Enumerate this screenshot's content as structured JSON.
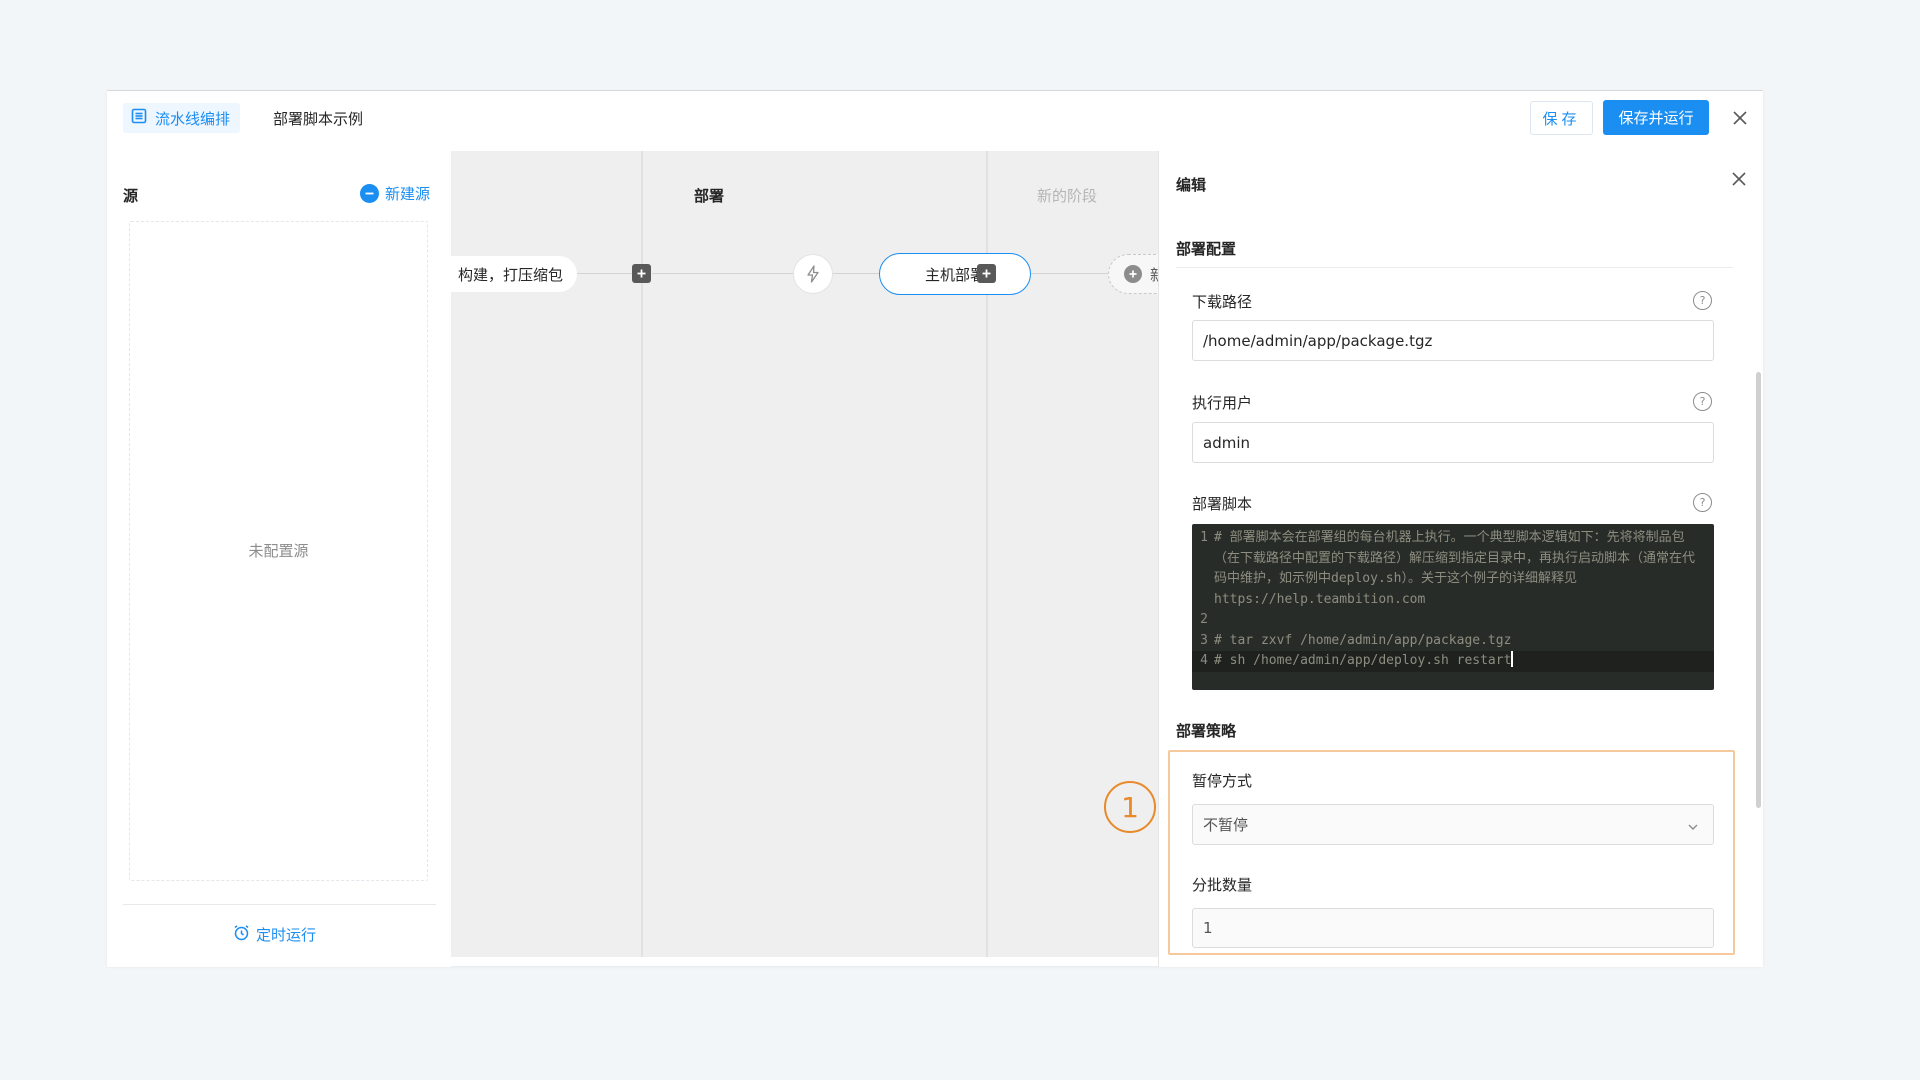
{
  "header": {
    "tab_active_label": "流水线编排",
    "tab_label": "部署脚本示例",
    "save_label": "保存",
    "save_run_label": "保存并运行"
  },
  "source": {
    "title": "源",
    "new_source_label": "新建源",
    "empty_text": "未配置源",
    "schedule_label": "定时运行"
  },
  "canvas": {
    "stages": [
      {
        "title": "部署"
      },
      {
        "title": "新的阶段"
      }
    ],
    "build_job_label": "构建，打压缩包",
    "deploy_job_label": "主机部署",
    "new_task_label": "新的任务"
  },
  "edit": {
    "title": "编辑",
    "deploy_config_title": "部署配置",
    "download_path_label": "下载路径",
    "download_path_value": "/home/admin/app/package.tgz",
    "exec_user_label": "执行用户",
    "exec_user_value": "admin",
    "script_label": "部署脚本",
    "script_lines": [
      {
        "n": "1",
        "text": "# 部署脚本会在部署组的每台机器上执行。一个典型脚本逻辑如下：先将将制品包（在下载路径中配置的下载路径）解压缩到指定目录中，再执行启动脚本（通常在代码中维护，如示例中deploy.sh）。关于这个例子的详细解释见https://help.teambition.com"
      },
      {
        "n": "2",
        "text": ""
      },
      {
        "n": "3",
        "text": "# tar zxvf /home/admin/app/package.tgz"
      },
      {
        "n": "4",
        "text": "# sh /home/admin/app/deploy.sh restart"
      }
    ],
    "strategy_title": "部署策略",
    "pause_label": "暂停方式",
    "pause_value": "不暂停",
    "batch_label": "分批数量",
    "batch_value": "1"
  },
  "callout_number": "1",
  "colors": {
    "accent": "#1b8ef2",
    "callout": "#e88a2a",
    "highlight": "#f5c99c",
    "code_bg": "#282c28"
  }
}
